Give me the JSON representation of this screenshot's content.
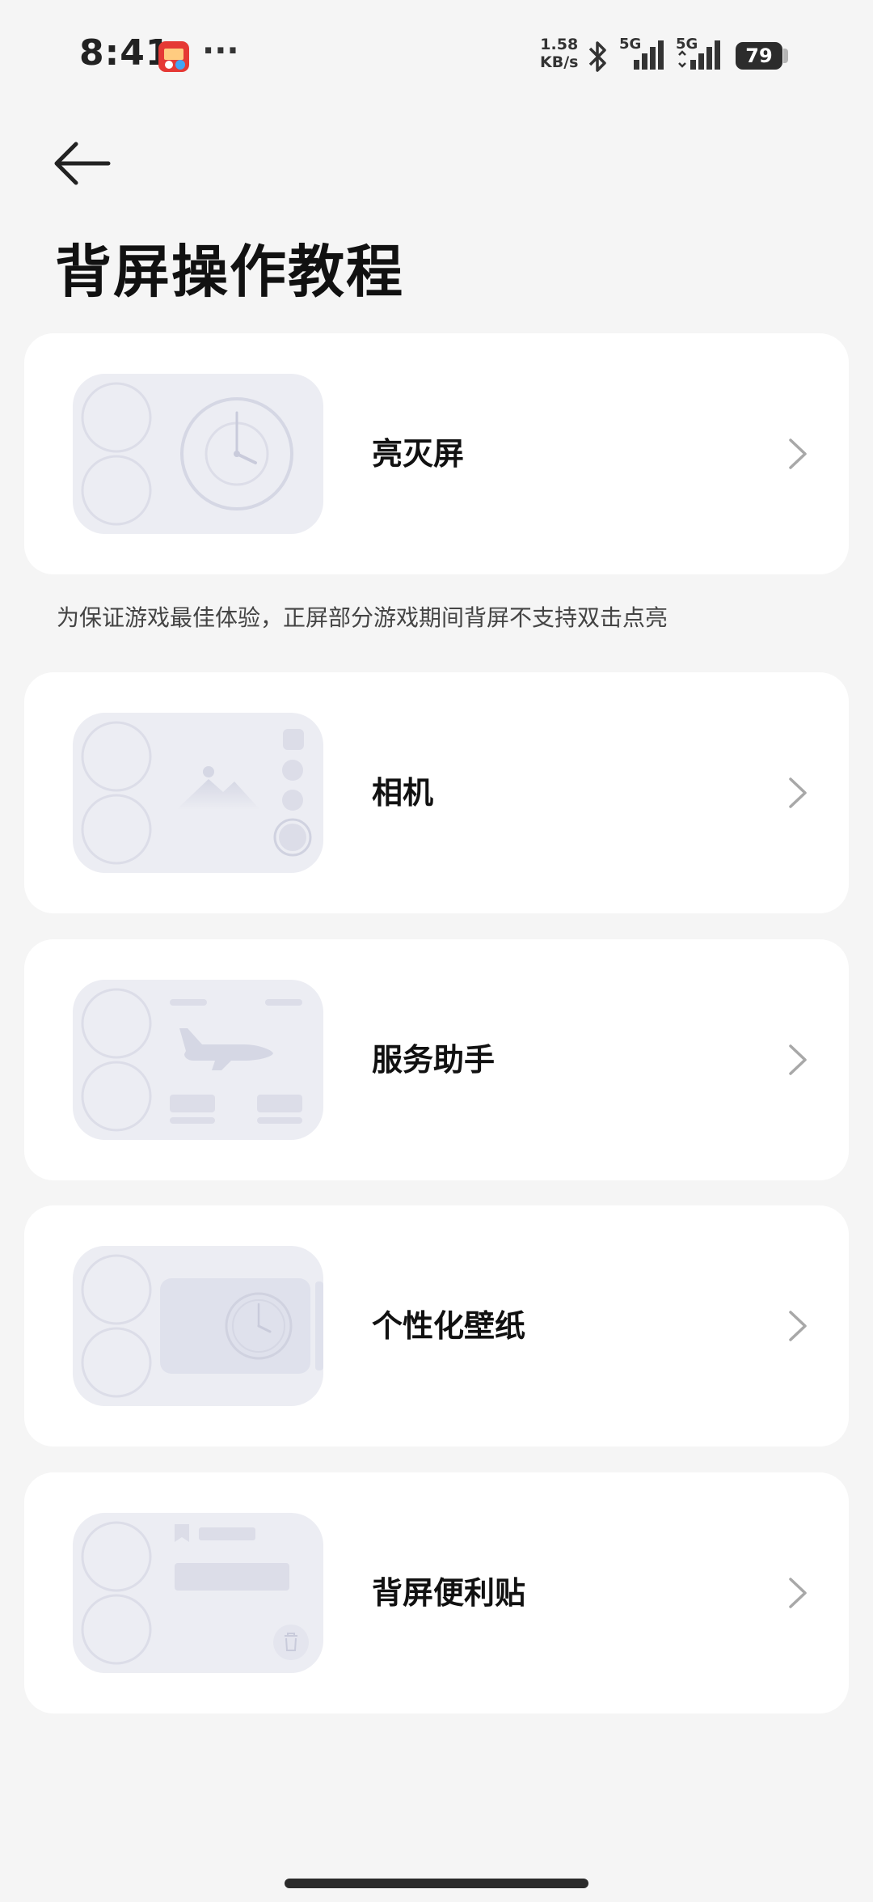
{
  "status_bar": {
    "time": "8:41",
    "more": "···",
    "net_speed_value": "1.58",
    "net_speed_unit": "KB/s",
    "signal1_label": "5G",
    "signal2_label": "5G",
    "battery": "79",
    "icons": [
      "app-notification-icon",
      "bluetooth-icon",
      "signal-icon",
      "battery-icon"
    ]
  },
  "header": {
    "back_icon": "back-arrow-icon",
    "title": "背屏操作教程"
  },
  "cards": [
    {
      "label": "亮灭屏",
      "thumb": "clock-thumbnail"
    },
    {
      "label": "相机",
      "thumb": "camera-thumbnail"
    },
    {
      "label": "服务助手",
      "thumb": "flight-service-thumbnail"
    },
    {
      "label": "个性化壁纸",
      "thumb": "wallpaper-thumbnail"
    },
    {
      "label": "背屏便利贴",
      "thumb": "sticky-note-thumbnail"
    }
  ],
  "hint": "为保证游戏最佳体验，正屏部分游戏期间背屏不支持双击点亮",
  "colors": {
    "background": "#f5f5f5",
    "card": "#ffffff",
    "thumb_bg": "#ecedf3",
    "thumb_stroke": "#d5d7e4"
  }
}
